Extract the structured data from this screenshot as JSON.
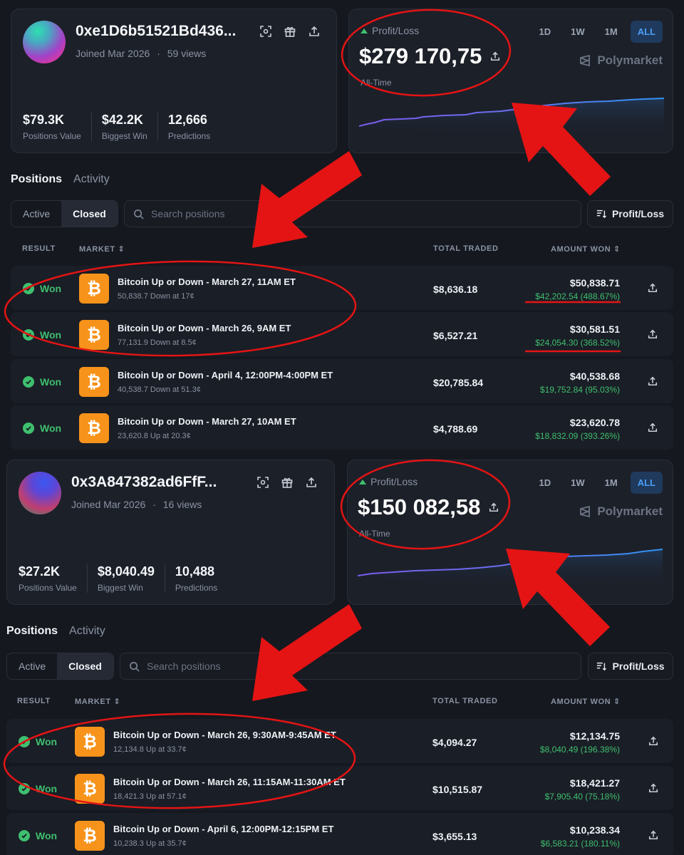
{
  "profiles": [
    {
      "address": "0xe1D6b51521Bd436...",
      "joined": "Joined Mar 2026",
      "views": "59 views",
      "stats": [
        {
          "value": "$79.3K",
          "label": "Positions Value"
        },
        {
          "value": "$42.2K",
          "label": "Biggest Win"
        },
        {
          "value": "12,666",
          "label": "Predictions"
        }
      ],
      "pnl": {
        "label": "Profit/Loss",
        "value": "$279 170,75",
        "period": "All-Time",
        "ranges": [
          "1D",
          "1W",
          "1M",
          "ALL"
        ],
        "active_range": "ALL",
        "brand": "Polymarket"
      },
      "tabs": {
        "positions": "Positions",
        "activity": "Activity"
      },
      "filter": {
        "active": "Active",
        "closed": "Closed"
      },
      "search_placeholder": "Search positions",
      "sort_label": "Profit/Loss",
      "columns": {
        "result": "RESULT",
        "market": "MARKET",
        "total": "TOTAL TRADED",
        "amount": "AMOUNT WON"
      },
      "rows": [
        {
          "result": "Won",
          "title": "Bitcoin Up or Down - March 27, 11AM ET",
          "sub": "50,838.7 Down at 17¢",
          "traded": "$8,636.18",
          "amount": "$50,838.71",
          "gain": "$42,202.54 (488.67%)"
        },
        {
          "result": "Won",
          "title": "Bitcoin Up or Down - March 26, 9AM ET",
          "sub": "77,131.9 Down at 8.5¢",
          "traded": "$6,527.21",
          "amount": "$30,581.51",
          "gain": "$24,054.30 (368.52%)"
        },
        {
          "result": "Won",
          "title": "Bitcoin Up or Down - April 4, 12:00PM-4:00PM ET",
          "sub": "40,538.7 Down at 51.3¢",
          "traded": "$20,785.84",
          "amount": "$40,538.68",
          "gain": "$19,752.84 (95.03%)"
        },
        {
          "result": "Won",
          "title": "Bitcoin Up or Down - March 27, 10AM ET",
          "sub": "23,620.8 Up at 20.3¢",
          "traded": "$4,788.69",
          "amount": "$23,620.78",
          "gain": "$18,832.09 (393.26%)"
        }
      ]
    },
    {
      "address": "0x3A847382ad6FfF...",
      "joined": "Joined Mar 2026",
      "views": "16 views",
      "stats": [
        {
          "value": "$27.2K",
          "label": "Positions Value"
        },
        {
          "value": "$8,040.49",
          "label": "Biggest Win"
        },
        {
          "value": "10,488",
          "label": "Predictions"
        }
      ],
      "pnl": {
        "label": "Profit/Loss",
        "value": "$150 082,58",
        "period": "All-Time",
        "ranges": [
          "1D",
          "1W",
          "1M",
          "ALL"
        ],
        "active_range": "ALL",
        "brand": "Polymarket"
      },
      "tabs": {
        "positions": "Positions",
        "activity": "Activity"
      },
      "filter": {
        "active": "Active",
        "closed": "Closed"
      },
      "search_placeholder": "Search positions",
      "sort_label": "Profit/Loss",
      "columns": {
        "result": "RESULT",
        "market": "MARKET",
        "total": "TOTAL TRADED",
        "amount": "AMOUNT WON"
      },
      "rows": [
        {
          "result": "Won",
          "title": "Bitcoin Up or Down - March 26, 9:30AM-9:45AM ET",
          "sub": "12,134.8 Up at 33.7¢",
          "traded": "$4,094.27",
          "amount": "$12,134.75",
          "gain": "$8,040.49 (196.38%)"
        },
        {
          "result": "Won",
          "title": "Bitcoin Up or Down - March 26, 11:15AM-11:30AM ET",
          "sub": "18,421.3 Up at 57.1¢",
          "traded": "$10,515.87",
          "amount": "$18,421.27",
          "gain": "$7,905.40 (75.18%)"
        },
        {
          "result": "Won",
          "title": "Bitcoin Up or Down - April 6, 12:00PM-12:15PM ET",
          "sub": "10,238.3 Up at 35.7¢",
          "traded": "$3,655.13",
          "amount": "$10,238.34",
          "gain": "$6,583.21 (180.11%)"
        }
      ]
    }
  ],
  "colors": {
    "background": "#15181f",
    "card": "#1c2029",
    "won_green": "#3fbf6f",
    "accent_blue": "#4c9df7",
    "bitcoin_orange": "#f7931a",
    "annotation_red": "#e41414"
  }
}
